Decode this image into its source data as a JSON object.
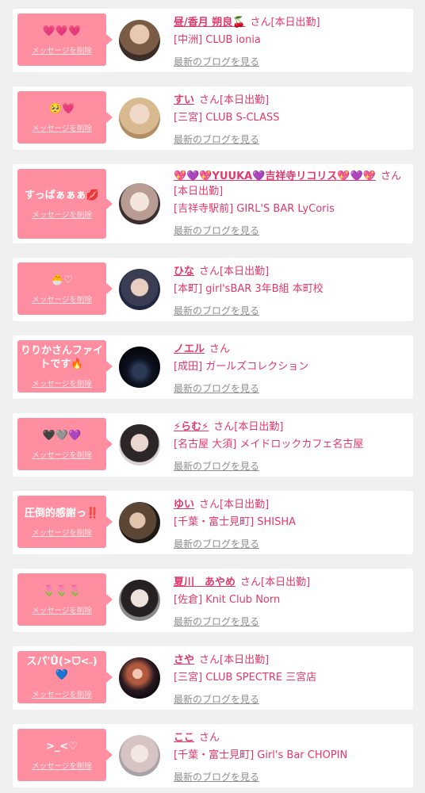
{
  "items": [
    {
      "name": "昼/香月 朔良🍒",
      "suffix": "さん",
      "status": "[本日出勤]",
      "shop": "[中洲] CLUB ionia",
      "message": "💗💗💗",
      "delete_label": "メッセージを削除",
      "blog_label": "最新のブログを見る",
      "avatar_icon": "avatar-photo"
    },
    {
      "name": "すい",
      "suffix": "さん",
      "status": "[本日出勤]",
      "shop": "[三宮] CLUB S-CLASS",
      "message": "🥺💗",
      "delete_label": "メッセージを削除",
      "blog_label": "最新のブログを見る",
      "avatar_icon": "avatar-photo"
    },
    {
      "name": "💖💜💖YUUKA💜吉祥寺リコリス💖💜💖",
      "suffix": "さん",
      "status": "[本日出勤]",
      "shop": "[吉祥寺駅前] GIRL'S BAR LyCoris",
      "message": "すっぱぁぁぁ💋",
      "delete_label": "メッセージを削除",
      "blog_label": "最新のブログを見る",
      "avatar_icon": "avatar-photo"
    },
    {
      "name": "ひな",
      "suffix": "さん",
      "status": "[本日出勤]",
      "shop": "[本町] girl'sBAR 3年B組 本町校",
      "message": "🐣♡",
      "delete_label": "メッセージを削除",
      "blog_label": "最新のブログを見る",
      "avatar_icon": "avatar-photo"
    },
    {
      "name": "ノエル",
      "suffix": "さん",
      "status": "",
      "shop": "[成田] ガールズコレクション",
      "message": "りりかさんファイトです🔥",
      "delete_label": "メッセージを削除",
      "blog_label": "最新のブログを見る",
      "avatar_icon": "avatar-photo"
    },
    {
      "name": "⚡らむ⚡",
      "suffix": "さん",
      "status": "[本日出勤]",
      "shop": "[名古屋 大須] メイドロックカフェ名古屋",
      "message": "🖤🩶💜",
      "delete_label": "メッセージを削除",
      "blog_label": "最新のブログを見る",
      "avatar_icon": "avatar-photo"
    },
    {
      "name": "ゆい",
      "suffix": "さん",
      "status": "[本日出勤]",
      "shop": "[千葉・富士見町] SHISHA",
      "message": "圧倒的感謝っ‼️",
      "delete_label": "メッセージを削除",
      "blog_label": "最新のブログを見る",
      "avatar_icon": "avatar-photo"
    },
    {
      "name": "夏川　あやめ",
      "suffix": "さん",
      "status": "[本日出勤]",
      "shop": "[佐倉] Knit Club Norn",
      "message": "🌷🌷🌷",
      "delete_label": "メッセージを削除",
      "blog_label": "最新のブログを見る",
      "avatar_icon": "avatar-photo"
    },
    {
      "name": "さや",
      "suffix": "さん",
      "status": "[本日出勤]",
      "shop": "[三宮] CLUB SPECTRE 三宮店",
      "message": "スパ'Ů(>ᗜ<˶)💙",
      "delete_label": "メッセージを削除",
      "blog_label": "最新のブログを見る",
      "avatar_icon": "avatar-photo"
    },
    {
      "name": "ここ",
      "suffix": "さん",
      "status": "",
      "shop": "[千葉・富士見町] Girl's Bar CHOPIN",
      "message": ">_<♡",
      "delete_label": "メッセージを削除",
      "blog_label": "最新のブログを見る",
      "avatar_icon": "avatar-photo"
    }
  ]
}
